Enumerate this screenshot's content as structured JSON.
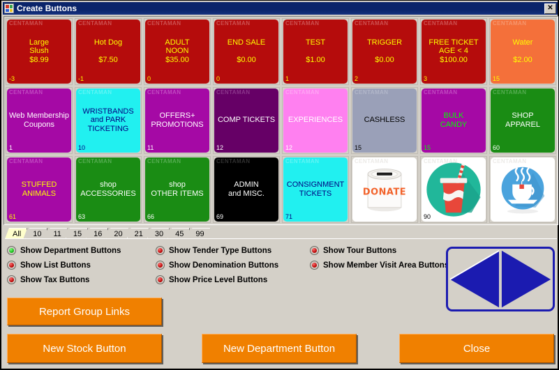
{
  "window": {
    "title": "Create Buttons",
    "icon": "app-squares-icon",
    "close_label": "✕",
    "icon_colors": [
      "#d33a2c",
      "#3aa34c",
      "#2c5fd3",
      "#e8c020"
    ]
  },
  "grid": {
    "header_text": "CENTAMAN",
    "buttons": [
      {
        "label": "Large\nSlush\n$8.99",
        "number": "-3",
        "bg": "#b50c0c",
        "fg": "#ffff00",
        "hdr": "#e08a8a",
        "type": "text"
      },
      {
        "label": "Hot Dog\n\n$7.50",
        "number": "-1",
        "bg": "#b50c0c",
        "fg": "#ffff00",
        "hdr": "#e08a8a",
        "type": "text"
      },
      {
        "label": "ADULT\nNOON\n$35.00",
        "number": "0",
        "bg": "#b50c0c",
        "fg": "#ffff00",
        "hdr": "#e08a8a",
        "type": "text"
      },
      {
        "label": "END SALE\n\n$0.00",
        "number": "0",
        "bg": "#b50c0c",
        "fg": "#ffff00",
        "hdr": "#e08a8a",
        "type": "text"
      },
      {
        "label": "TEST\n\n$1.00",
        "number": "1",
        "bg": "#b50c0c",
        "fg": "#ffff00",
        "hdr": "#e08a8a",
        "type": "text"
      },
      {
        "label": "TRIGGER\n\n$0.00",
        "number": "2",
        "bg": "#b50c0c",
        "fg": "#ffff00",
        "hdr": "#e08a8a",
        "type": "text"
      },
      {
        "label": "FREE TICKET\nAGE < 4\n$100.00",
        "number": "3",
        "bg": "#b50c0c",
        "fg": "#ffff00",
        "hdr": "#e08a8a",
        "type": "text"
      },
      {
        "label": "Water\n\n$2.00",
        "number": "15",
        "bg": "#f4703a",
        "fg": "#ffff00",
        "hdr": "#f8b596",
        "type": "text"
      },
      {
        "label": "Web Membership\nCoupons",
        "number": "1",
        "bg": "#a509a5",
        "fg": "#ffffff",
        "hdr": "#d77fd7",
        "type": "text"
      },
      {
        "label": "WRISTBANDS\nand PARK\nTICKETING",
        "number": "10",
        "bg": "#21f0f0",
        "fg": "#000080",
        "hdr": "#96f7f7",
        "type": "text"
      },
      {
        "label": "OFFERS+\nPROMOTIONS",
        "number": "11",
        "bg": "#a509a5",
        "fg": "#ffffff",
        "hdr": "#d77fd7",
        "type": "text"
      },
      {
        "label": "COMP TICKETS",
        "number": "12",
        "bg": "#660066",
        "fg": "#ffffff",
        "hdr": "#a861a8",
        "type": "text"
      },
      {
        "label": "EXPERIENCES",
        "number": "12",
        "bg": "#ff80f0",
        "fg": "#ffffff",
        "hdr": "#ffc2f7",
        "type": "text"
      },
      {
        "label": "CASHLESS",
        "number": "15",
        "bg": "#9aa0b8",
        "fg": "#000000",
        "hdr": "#c5c9d8",
        "type": "text"
      },
      {
        "label": "BULK\nCANDY",
        "number": "15",
        "bg": "#a509a5",
        "fg": "#00ff00",
        "hdr": "#d77fd7",
        "type": "text"
      },
      {
        "label": "SHOP\nAPPAREL",
        "number": "60",
        "bg": "#1a8c14",
        "fg": "#ffffff",
        "hdr": "#86c683",
        "type": "text"
      },
      {
        "label": "STUFFED\nANIMALS",
        "number": "61",
        "bg": "#a509a5",
        "fg": "#ffff00",
        "hdr": "#d77fd7",
        "type": "text"
      },
      {
        "label": "shop\nACCESSORIES",
        "number": "63",
        "bg": "#1a8c14",
        "fg": "#ffffff",
        "hdr": "#86c683",
        "type": "text"
      },
      {
        "label": "shop\nOTHER ITEMS",
        "number": "66",
        "bg": "#1a8c14",
        "fg": "#ffffff",
        "hdr": "#86c683",
        "type": "text"
      },
      {
        "label": "ADMIN\nand MISC.",
        "number": "69",
        "bg": "#000000",
        "fg": "#ffffff",
        "hdr": "#5a5a5a",
        "type": "text"
      },
      {
        "label": "CONSIGNMENT\nTICKETS",
        "number": "71",
        "bg": "#21f0f0",
        "fg": "#000080",
        "hdr": "#96f7f7",
        "type": "text"
      },
      {
        "label": "",
        "number": "",
        "bg": "#ffffff",
        "fg": "#000000",
        "hdr": "#d8d8d8",
        "type": "image",
        "art": "donate-can-icon"
      },
      {
        "label": "",
        "number": "90",
        "bg": "#ffffff",
        "fg": "#000000",
        "hdr": "#d8d8d8",
        "type": "image",
        "art": "soda-cup-icon"
      },
      {
        "label": "",
        "number": "",
        "bg": "#ffffff",
        "fg": "#000000",
        "hdr": "#d8d8d8",
        "type": "image",
        "art": "tea-cup-icon"
      }
    ]
  },
  "tabs": {
    "active": "All",
    "items": [
      "All",
      "10",
      "11",
      "15",
      "16",
      "20",
      "21",
      "30",
      "45",
      "99"
    ]
  },
  "options": [
    {
      "label": "Show Department Buttons",
      "state": "on"
    },
    {
      "label": "Show List Buttons",
      "state": "off"
    },
    {
      "label": "Show Tax Buttons",
      "state": "off"
    },
    {
      "label": "Show Tender Type Buttons",
      "state": "off"
    },
    {
      "label": "Show Denomination Buttons",
      "state": "off"
    },
    {
      "label": "Show Price Level Buttons",
      "state": "off"
    },
    {
      "label": "Show Tour Buttons",
      "state": "off"
    },
    {
      "label": "Show Member Visit Area Buttons",
      "state": "off"
    }
  ],
  "nav": {
    "name": "prev-next-diamond",
    "color": "#1b1bb0"
  },
  "actions": {
    "report_group_links": "Report Group Links",
    "new_stock_button": "New Stock Button",
    "new_department_button": "New Department Button",
    "close": "Close"
  }
}
